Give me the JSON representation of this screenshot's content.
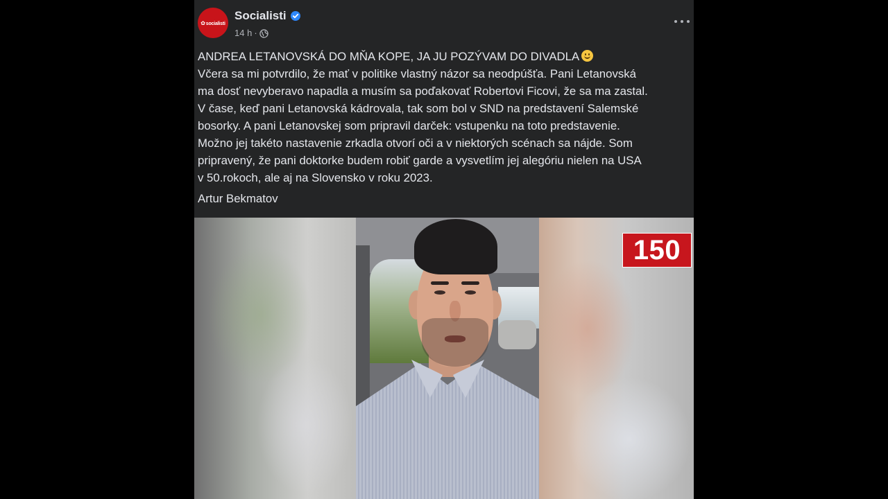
{
  "post": {
    "page_name": "Socialisti",
    "avatar_logo_text": "socialisti",
    "verified": true,
    "timestamp": "14 h",
    "meta_separator": "·",
    "audience_icon": "globe-icon",
    "menu_icon": "more-horizontal-icon",
    "body_lines": [
      "ANDREA LETANOVSKÁ DO MŇA KOPE, JA JU POZÝVAM DO DIVADLA",
      "Včera sa mi potvrdilo, že mať v politike vlastný názor sa neodpúšťa. Pani Letanovská",
      "ma dosť nevyberavo napadla a musím sa poďakovať Robertovi Ficovi, že sa ma zastal.",
      "V čase, keď pani Letanovská kádrovala, tak som bol v SND na predstavení Salemské",
      "bosorky. A pani Letanovskej som pripravil darček: vstupenku na toto predstavenie.",
      "Možno jej takéto nastavenie zrkadla otvorí oči a v niektorých scénach sa nájde. Som",
      "pripravený, že pani doktorke budem robiť garde a vysvetlím jej alegóriu nielen na USA",
      "v 50.rokoch, ale aj na Slovensko v roku 2023."
    ],
    "title_emoji": "smiling-face-icon",
    "signature": "Artur Bekmatov"
  },
  "media": {
    "badge_text": "150",
    "colors": {
      "badge_background": "#c7161d",
      "post_background": "#242526",
      "text": "#e4e6eb",
      "secondary_text": "#b0b3b8",
      "verified": "#2d88ff",
      "avatar": "#c8141a"
    }
  }
}
